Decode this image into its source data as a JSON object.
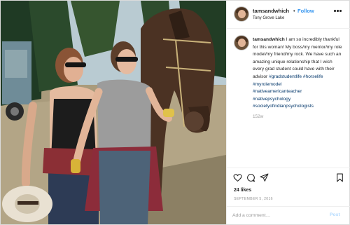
{
  "post": {
    "username": "tamsandwhich",
    "follow_label": "Follow",
    "location": "Tony Grove Lake",
    "caption": {
      "username": "tamsandwhich",
      "text": "I am so incredibly thankful for this woman! My boss/my mentor/my role model/my friend/my rock. We have such an amazing unique relationship that I wish every grad student could have with their advisor",
      "hashtags": [
        "#gradstudentlife",
        "#horselife",
        "#myrolemodel",
        "#nativeamericanteacher",
        "#nativepsychology",
        "#societyofindianpsychologists"
      ],
      "time_ago": "152w"
    },
    "likes": "24 likes",
    "date": "SEPTEMBER 5, 2016",
    "comment": {
      "placeholder": "Add a comment…",
      "post_label": "Post"
    }
  },
  "icons": {
    "more": "more-options-icon",
    "like": "heart-icon",
    "comment": "comment-icon",
    "share": "share-icon",
    "save": "bookmark-icon"
  },
  "colors": {
    "link": "#3897f0",
    "hashtag": "#003569",
    "muted": "#999999",
    "post_disabled": "#b3dbff"
  }
}
